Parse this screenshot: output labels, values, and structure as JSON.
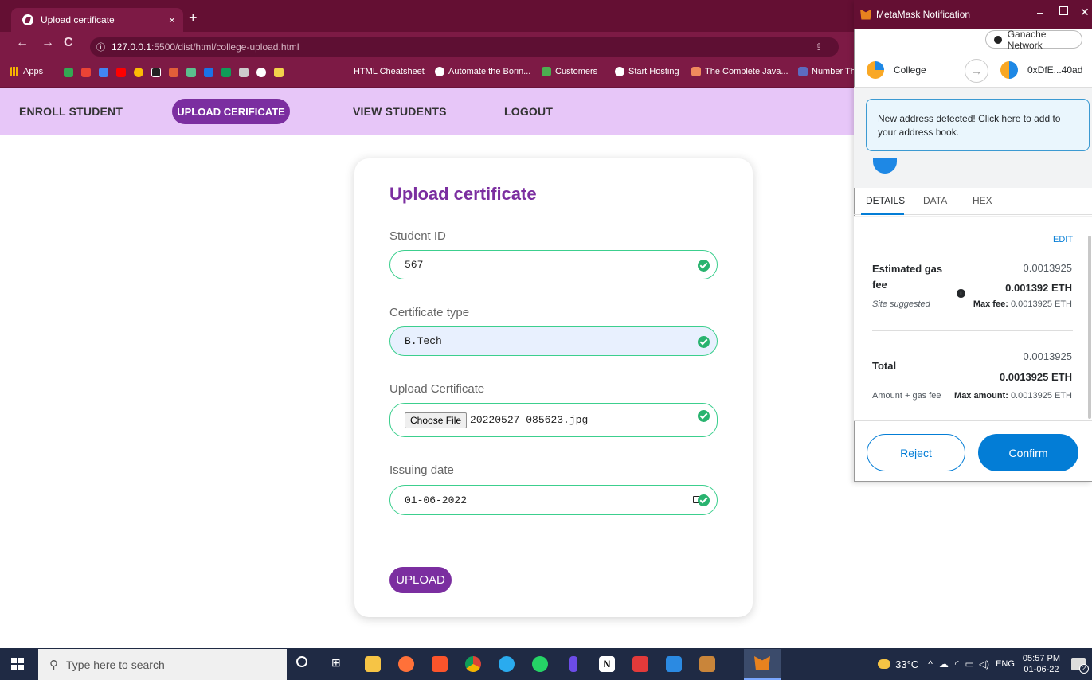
{
  "browser": {
    "tab_title": "Upload certificate",
    "tab_close": "×",
    "new_tab": "+",
    "url_host": "127.0.0.1",
    "url_path": ":5500/dist/html/college-upload.html",
    "bookmarks": {
      "apps": "Apps",
      "items": [
        "HTML Cheatsheet",
        "Automate the Borin...",
        "Customers",
        "Start Hosting",
        "The Complete Java...",
        "Number Th"
      ]
    }
  },
  "app_nav": {
    "enroll": "ENROLL STUDENT",
    "upload": "UPLOAD CERIFICATE",
    "view": "VIEW STUDENTS",
    "logout": "LOGOUT"
  },
  "form": {
    "title": "Upload certificate",
    "student_id_label": "Student ID",
    "student_id_value": "567",
    "cert_type_label": "Certificate type",
    "cert_type_value": "B.Tech",
    "upload_label": "Upload Certificate",
    "choose_file": "Choose File",
    "file_name": "20220527_085623.jpg",
    "issuing_label": "Issuing date",
    "issuing_value": "01-06-2022",
    "upload_button": "UPLOAD"
  },
  "metamask": {
    "window_title": "MetaMask Notification",
    "network": "Ganache Network",
    "from_account": "College",
    "to_account": "0xDfE...40ad",
    "notice": "New address detected! Click here to add to your address book.",
    "tabs": [
      "DETAILS",
      "DATA",
      "HEX"
    ],
    "edit": "EDIT",
    "gas_label": "Estimated gas fee",
    "gas_value": "0.0013925",
    "gas_eth": "0.001392 ETH",
    "site_suggested": "Site suggested",
    "max_fee_label": "Max fee:",
    "max_fee_value": "0.0013925 ETH",
    "total_label": "Total",
    "total_value": "0.0013925",
    "total_eth": "0.0013925 ETH",
    "amount_gas": "Amount + gas fee",
    "max_amount_label": "Max amount:",
    "max_amount_value": "0.0013925 ETH",
    "reject": "Reject",
    "confirm": "Confirm"
  },
  "taskbar": {
    "search_placeholder": "Type here to search",
    "temperature": "33°C",
    "lang": "ENG",
    "time": "05:57 PM",
    "date": "01-06-22",
    "notif_count": "2"
  },
  "colors": {
    "accent_purple": "#7b2ea0",
    "nav_bg": "#e7c6f8",
    "field_border": "#3ccf8e",
    "metamask_blue": "#037dd6",
    "browser_maroon": "#7d1a45"
  }
}
